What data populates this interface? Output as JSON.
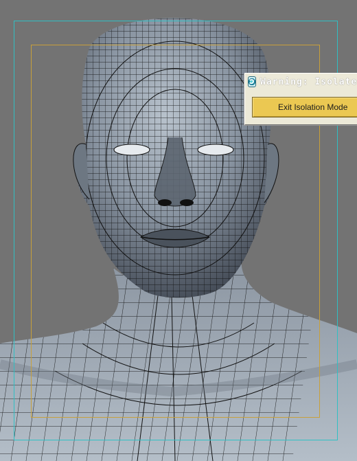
{
  "viewport": {
    "object": "male head mesh (wireframe on shaded)",
    "colors": {
      "background": "#737373",
      "safe_frame_outer": "#2fc0c4",
      "safe_frame_inner": "#c8a03a",
      "mesh_fill": "#5a6470",
      "wire": "#111111"
    }
  },
  "dialog": {
    "icon": "3dsmax-app-icon",
    "title": "Warning: Isolate..",
    "button_label": "Exit Isolation Mode",
    "button_color": "#ebc852"
  }
}
